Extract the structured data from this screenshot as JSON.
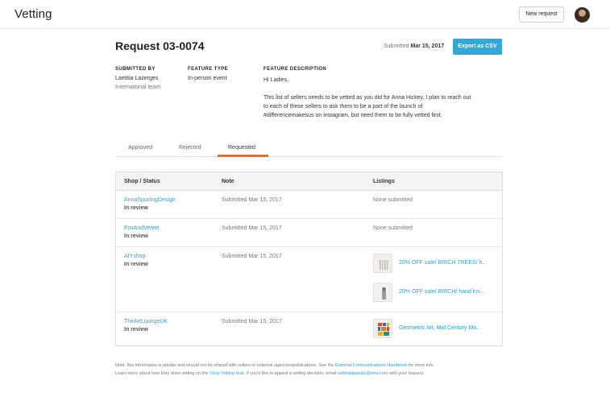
{
  "header": {
    "title": "Vetting",
    "new_request_label": "New request"
  },
  "request": {
    "title": "Request 03-0074",
    "submitted_label": "Submitted",
    "submitted_date": "Mar 15, 2017",
    "export_label": "Export as CSV",
    "submitted_by_label": "SUBMITTED BY",
    "submitted_by_name": "Laetitia Lazerges",
    "submitted_by_team": "International team",
    "feature_type_label": "FEATURE TYPE",
    "feature_type_value": "In-person event",
    "feature_desc_label": "FEATURE DESCRIPTION",
    "feature_desc_greeting": "Hi Ladies,",
    "feature_desc_body": "This list of sellers needs to be vetted as you did for Anna Hickey. I plan to reach out to each of these sellers to ask them to be a part of the launch of #differencemakesus on instagram, but need them to be fully vetted first."
  },
  "tabs": [
    {
      "label": "Approved",
      "active": false
    },
    {
      "label": "Rejected",
      "active": false
    },
    {
      "label": "Requested",
      "active": true
    }
  ],
  "table": {
    "headers": [
      "Shop / Status",
      "Note",
      "Listings"
    ],
    "rows": [
      {
        "shop": "AnnaSpurlingDesign",
        "status": "In review",
        "note": "Submitted Mar 15, 2017",
        "listings_none": "None submitted"
      },
      {
        "shop": "FoxAndVelvet",
        "status": "In review",
        "note": "Submitted Mar 15, 2017",
        "listings_none": "None submitted"
      },
      {
        "shop": "AIYshop",
        "status": "In review",
        "note": "Submitted Mar 15, 2017",
        "listings": [
          "20% OFF sale/ BIRCH TREES/ h...",
          "20% OFF sale/ BIRCH/ hand kni..."
        ]
      },
      {
        "shop": "TheArtLoungeUK",
        "status": "In review",
        "note": "Submitted Mar 15, 2017",
        "listings": [
          "Geometric Art, Mid Century Mo..."
        ]
      }
    ]
  },
  "footer": {
    "t1": "Note: this information is private and should not be shared with sellers or external agencies/publications. See the ",
    "l1": "External Communications Handbook",
    "t2": " for more info.",
    "t3": "Learn more about how Etsy does vetting on the ",
    "l2": "Shop Vetting Hub",
    "t4": ". If you'd like to appeal a vetting decision, email ",
    "l3": "vettingappeals@etsy.com",
    "t5": " with your request."
  },
  "colors": {
    "accent": "#36a6d6",
    "link": "#2a9fd0",
    "tab_active_underline": "#e0712c"
  },
  "icons": [
    "avatar"
  ]
}
